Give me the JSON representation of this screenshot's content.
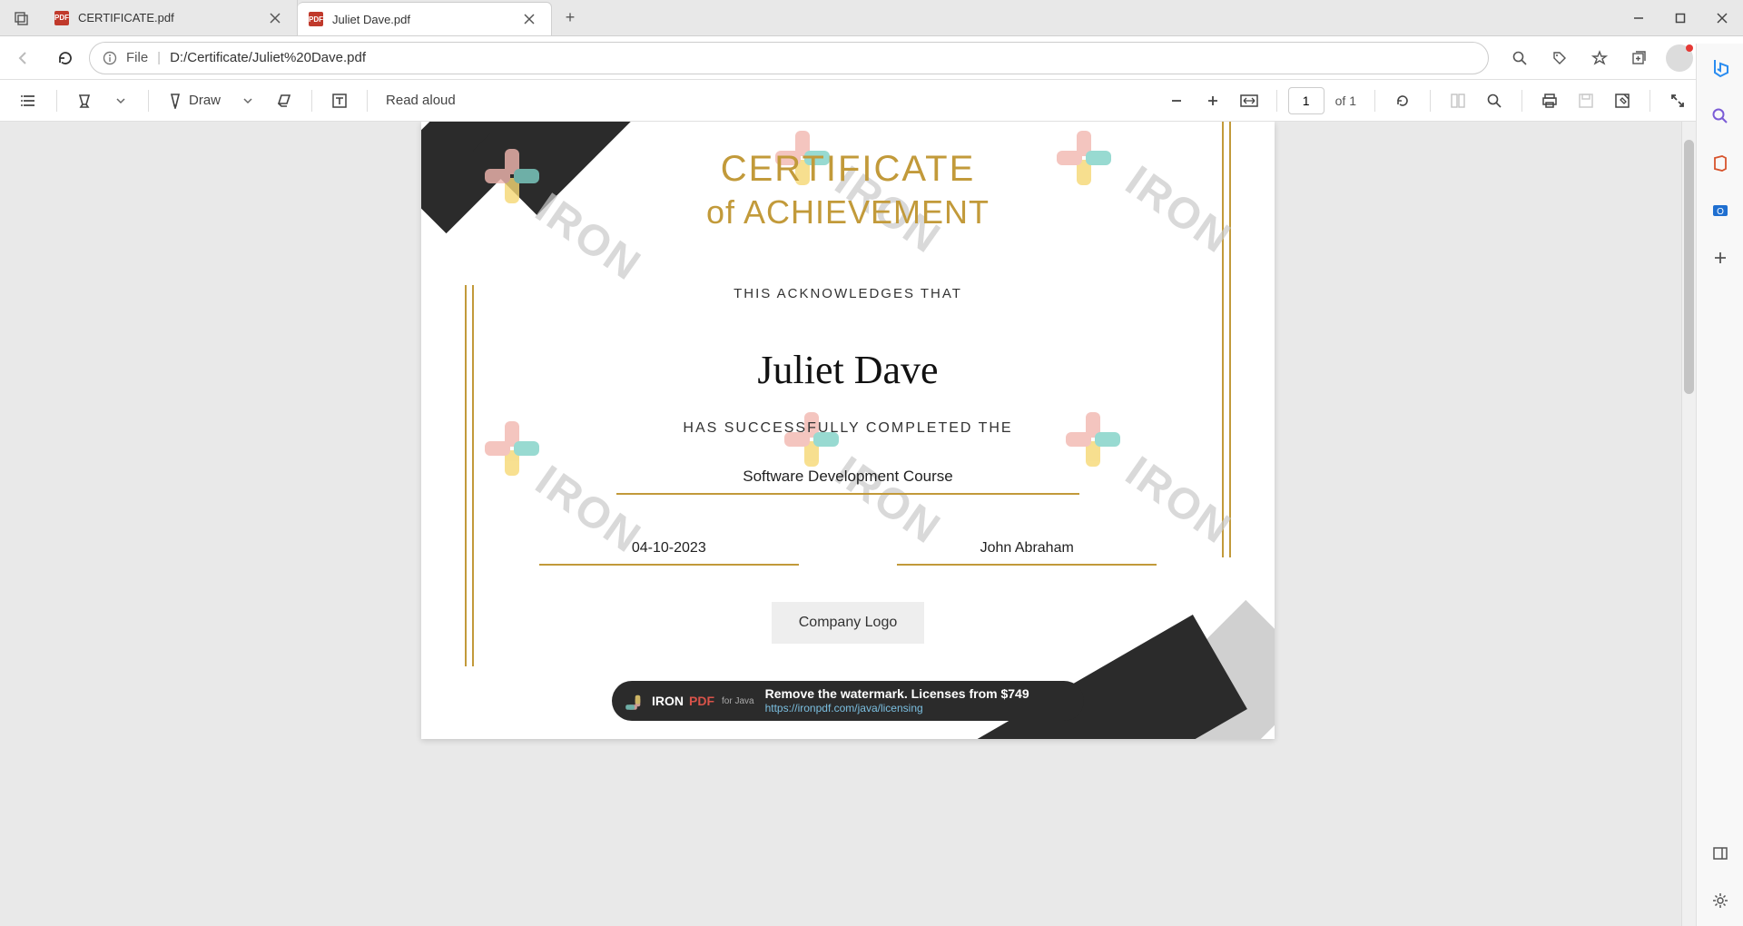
{
  "tabs": [
    {
      "label": "CERTIFICATE.pdf",
      "active": false
    },
    {
      "label": "Juliet Dave.pdf",
      "active": true
    }
  ],
  "address": {
    "scheme": "File",
    "url": "D:/Certificate/Juliet%20Dave.pdf"
  },
  "pdf_toolbar": {
    "draw_label": "Draw",
    "read_aloud_label": "Read aloud",
    "page_current": "1",
    "page_total": "of 1"
  },
  "certificate": {
    "title": "CERTIFICATE",
    "subtitle": "of ACHIEVEMENT",
    "ack": "THIS ACKNOWLEDGES THAT",
    "recipient": "Juliet Dave",
    "completed": "HAS SUCCESSFULLY COMPLETED THE",
    "course": "Software Development Course",
    "date": "04-10-2023",
    "signer": "John Abraham",
    "logo": "Company Logo",
    "watermark_text": "IRON"
  },
  "banner": {
    "brand_iron": "IRON",
    "brand_pdf": "PDF",
    "brand_for": "for Java",
    "message": "Remove the watermark. Licenses from $749",
    "link": "https://ironpdf.com/java/licensing"
  }
}
